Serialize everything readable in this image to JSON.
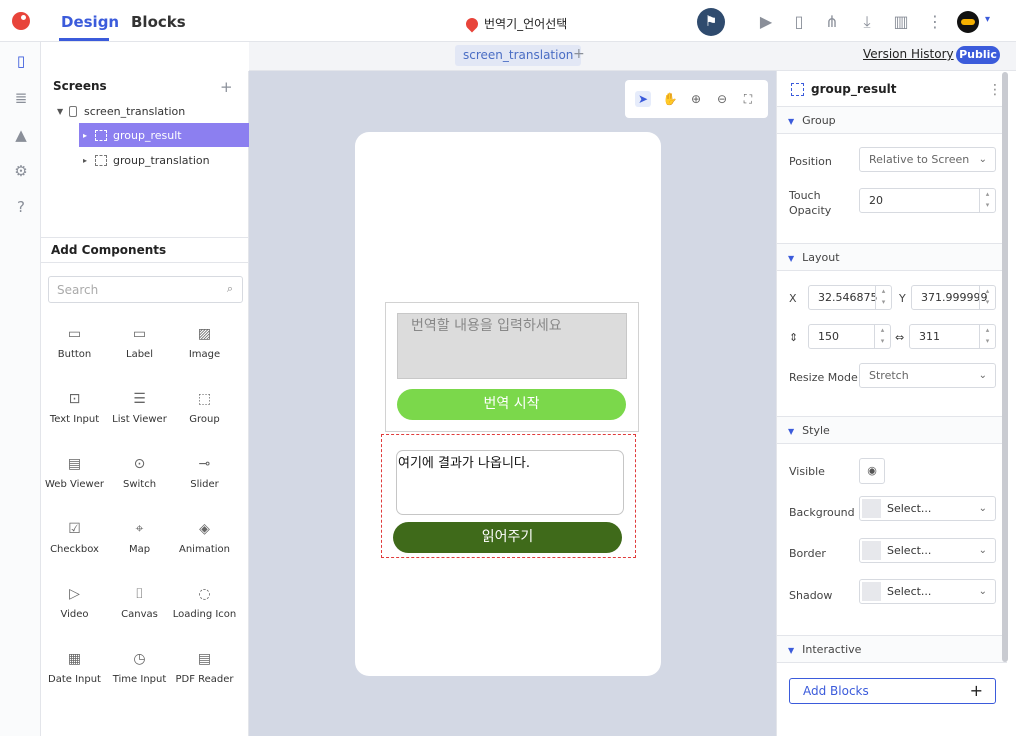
{
  "topbar": {
    "tab_design": "Design",
    "tab_blocks": "Blocks",
    "project_title": "번역기_언어선택"
  },
  "subbar": {
    "screen_tab": "screen_translation",
    "version_history": "Version History",
    "public": "Public"
  },
  "screens": {
    "header": "Screens",
    "items": [
      {
        "label": "screen_translation"
      },
      {
        "label": "group_result"
      },
      {
        "label": "group_translation"
      }
    ]
  },
  "add_components": {
    "header": "Add Components",
    "search_placeholder": "Search",
    "items": [
      "Button",
      "Label",
      "Image",
      "Text Input",
      "List Viewer",
      "Group",
      "Web Viewer",
      "Switch",
      "Slider",
      "Checkbox",
      "Map",
      "Animation",
      "Video",
      "Canvas",
      "Loading Icon",
      "Date Input",
      "Time Input",
      "PDF Reader"
    ]
  },
  "phone": {
    "input_placeholder": "번역할 내용을 입력하세요",
    "translate_button": "번역 시작",
    "result_text": "여기에 결과가 나옵니다.",
    "read_button": "읽어주기"
  },
  "properties": {
    "title": "group_result",
    "sections": {
      "group": "Group",
      "layout": "Layout",
      "style": "Style",
      "interactive": "Interactive"
    },
    "position_label": "Position",
    "position_value": "Relative to Screen",
    "touch_opacity_label": "Touch Opacity",
    "touch_opacity_value": "20",
    "x_label": "X",
    "x_value": "32.546875",
    "y_label": "Y",
    "y_value": "371.999999",
    "width_value": "150",
    "height_value": "311",
    "resize_mode_label": "Resize Mode",
    "resize_mode_value": "Stretch",
    "visible_label": "Visible",
    "background_label": "Background",
    "background_value": "Select...",
    "border_label": "Border",
    "border_value": "Select...",
    "shadow_label": "Shadow",
    "shadow_value": "Select...",
    "add_blocks": "Add Blocks"
  },
  "colors": {
    "accent": "#3b5bdb",
    "selected_row": "#8c7ff0",
    "translate_button": "#7bd84b",
    "read_button": "#3f6a1a",
    "canvas_bg": "#d3d8e4"
  }
}
